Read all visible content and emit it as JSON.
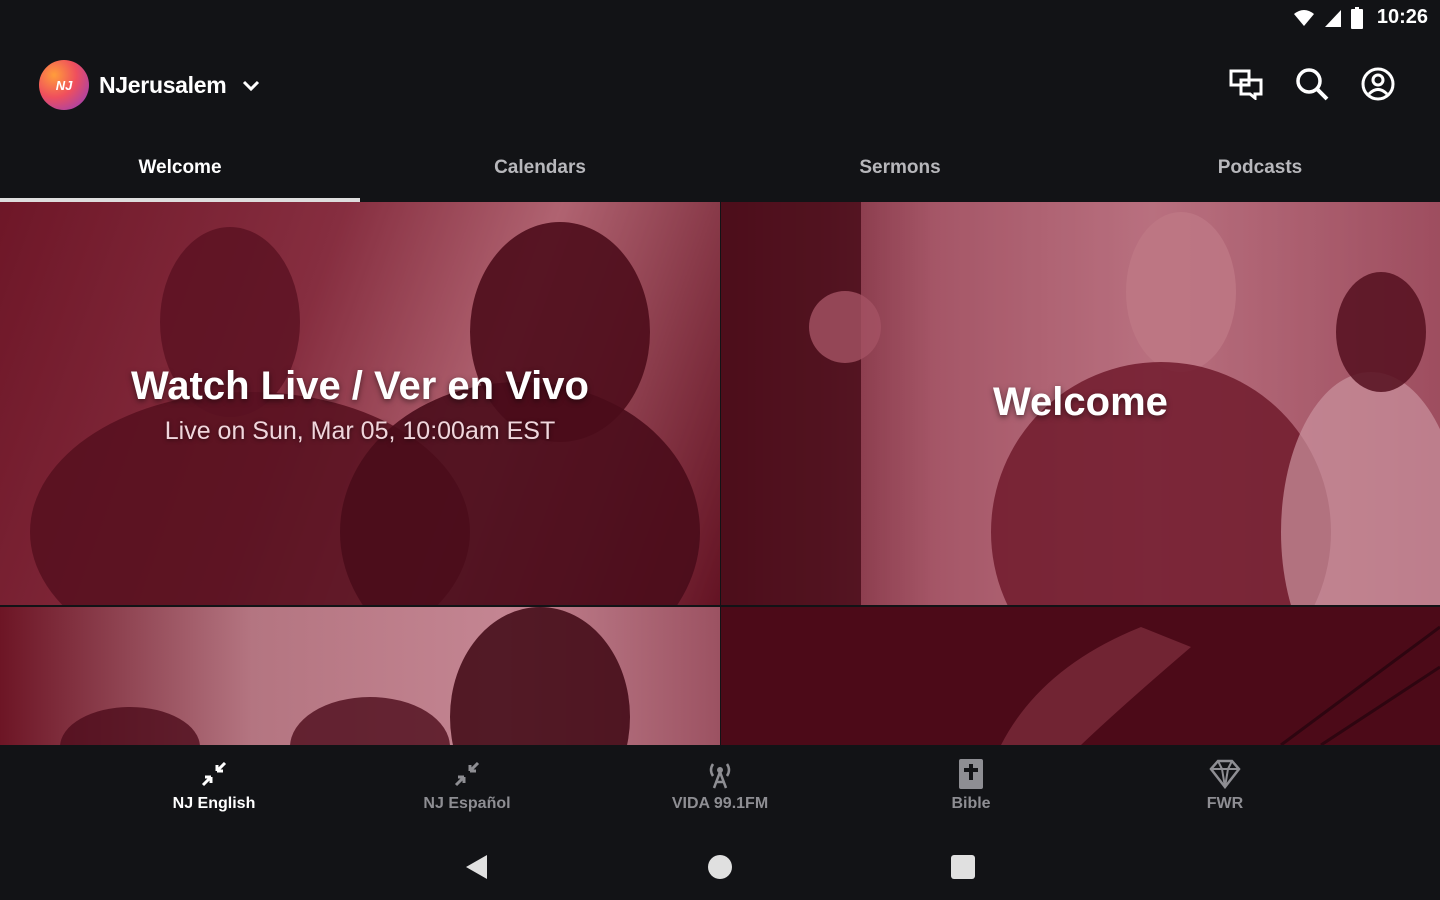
{
  "status": {
    "time": "10:26"
  },
  "header": {
    "church_name": "NJerusalem",
    "logo_text": "NJ"
  },
  "tabs": [
    {
      "label": "Welcome",
      "active": true
    },
    {
      "label": "Calendars",
      "active": false
    },
    {
      "label": "Sermons",
      "active": false
    },
    {
      "label": "Podcasts",
      "active": false
    }
  ],
  "tiles": {
    "watch_live": {
      "title": "Watch Live / Ver en Vivo",
      "subtitle": "Live on Sun, Mar 05, 10:00am EST"
    },
    "welcome": {
      "title": "Welcome"
    }
  },
  "bottom_nav": [
    {
      "label": "NJ English",
      "icon": "collapse-arrows-icon",
      "active": true
    },
    {
      "label": "NJ Español",
      "icon": "collapse-arrows-icon",
      "active": false
    },
    {
      "label": "VIDA 99.1FM",
      "icon": "radio-tower-icon",
      "active": false
    },
    {
      "label": "Bible",
      "icon": "bible-icon",
      "active": false
    },
    {
      "label": "FWR",
      "icon": "diamond-icon",
      "active": false
    }
  ],
  "colors": {
    "background": "#121316",
    "tile_tint": "#7a1f33",
    "accent_inactive": "#8e8e93"
  }
}
